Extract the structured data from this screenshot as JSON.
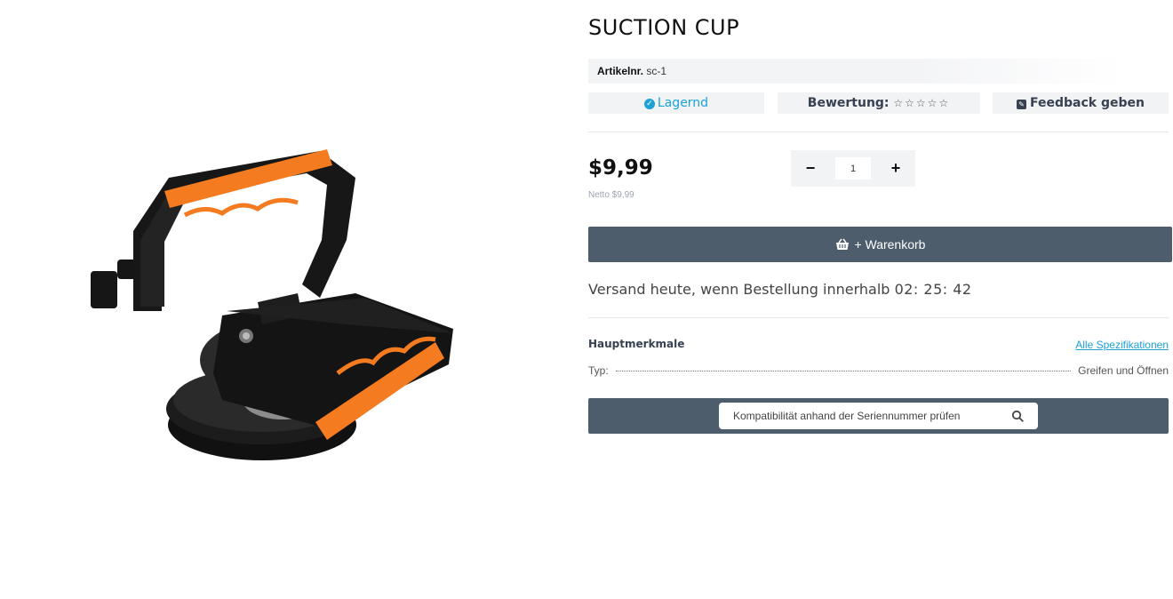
{
  "product": {
    "title": "SUCTION CUP",
    "sku_label": "Artikelnr.",
    "sku_value": "sc-1",
    "stock_label": "Lagernd",
    "rating_label": "Bewertung:",
    "rating_stars": "☆☆☆☆☆",
    "rating_value": 0,
    "feedback_label": "Feedback geben",
    "price": "$9,99",
    "netto": "Netto $9,99",
    "quantity": "1",
    "qty_minus": "−",
    "qty_plus": "+",
    "cart_label": "+ Warenkorb",
    "shipping_text": "Versand heute, wenn Bestellung innerhalb",
    "shipping_timer": "02: 25: 42",
    "features_title": "Hauptmerkmale",
    "all_specs_link": "Alle Spezifikationen",
    "feature_key": "Typ:",
    "feature_value": "Greifen und Öffnen",
    "serial_placeholder": "Kompatibilität anhand der Seriennummer prüfen"
  },
  "colors": {
    "accent": "#1da1d6",
    "button_bg": "#4e5d6c",
    "pill_bg": "#f1f3f5",
    "product_orange": "#f47b20"
  },
  "icons": {
    "stock": "check-circle-icon",
    "feedback": "edit-icon",
    "cart": "basket-icon",
    "search": "search-icon"
  }
}
